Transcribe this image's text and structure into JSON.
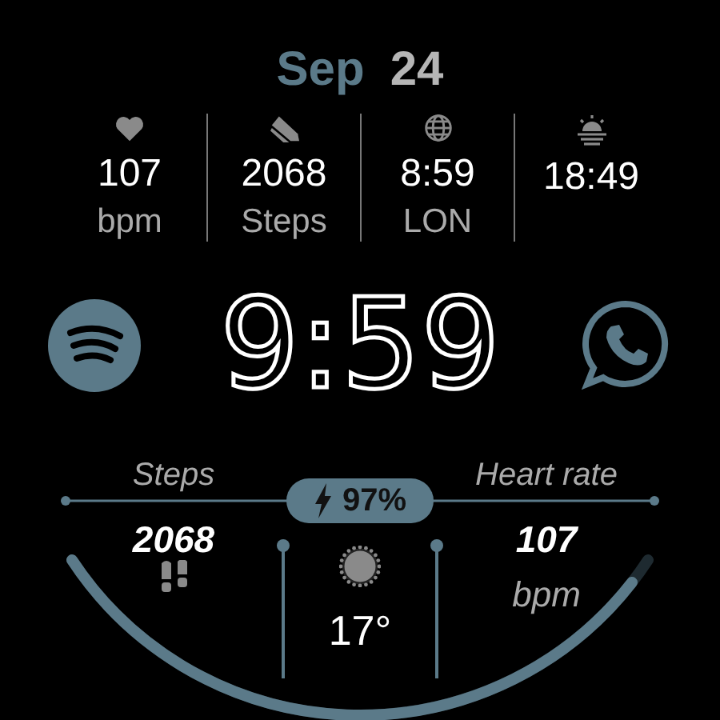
{
  "date": {
    "month": "Sep",
    "day": "24"
  },
  "stats": [
    {
      "kind": "heart",
      "value": "107",
      "label": "bpm"
    },
    {
      "kind": "steps",
      "value": "2068",
      "label": "Steps"
    },
    {
      "kind": "world",
      "value": "8:59",
      "label": "LON"
    },
    {
      "kind": "sunset",
      "value": "18:49"
    }
  ],
  "time": "9:59",
  "battery": {
    "reading": "97%"
  },
  "steps_panel": {
    "title": "Steps",
    "value": "2068"
  },
  "weather": {
    "temperature": "17°"
  },
  "heart_panel": {
    "title": "Heart rate",
    "value": "107",
    "unit": "bpm"
  }
}
